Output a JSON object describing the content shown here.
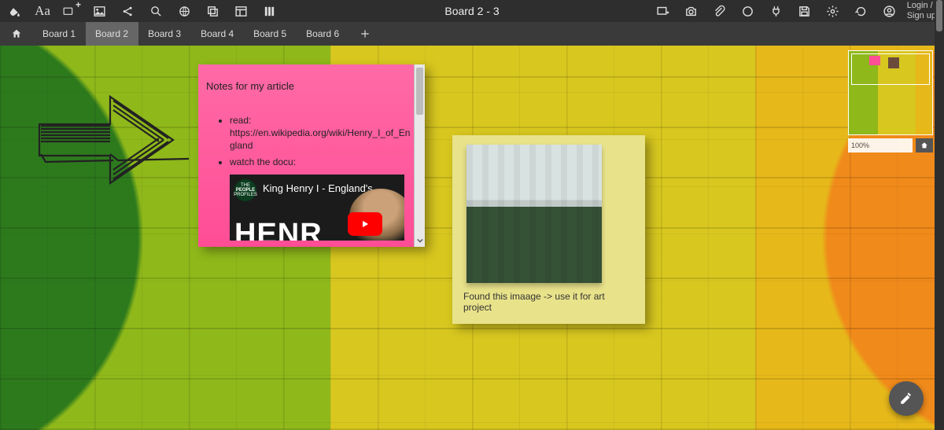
{
  "header": {
    "title": "Board 2 - 3",
    "auth_login": "Login /",
    "auth_signup": "Sign up"
  },
  "tabs": {
    "items": [
      {
        "label": "Board 1"
      },
      {
        "label": "Board 2"
      },
      {
        "label": "Board 3"
      },
      {
        "label": "Board 4"
      },
      {
        "label": "Board 5"
      },
      {
        "label": "Board 6"
      }
    ],
    "active_index": 1
  },
  "pink_note": {
    "title": "Notes for my article",
    "bullet1_lead": "read:",
    "bullet1_link": "https://en.wikipedia.org/wiki/Henry_I_of_England",
    "bullet2": "watch the docu:",
    "video_title": "King Henry I - England's …",
    "video_bigtext": "HENR",
    "badge_top": "THE",
    "badge_mid": "PEOPLE",
    "badge_bot": "PROFILES"
  },
  "yellow_note": {
    "caption": "Found this imaage -> use it for art project"
  },
  "minimap": {
    "zoom_label": "100%"
  }
}
